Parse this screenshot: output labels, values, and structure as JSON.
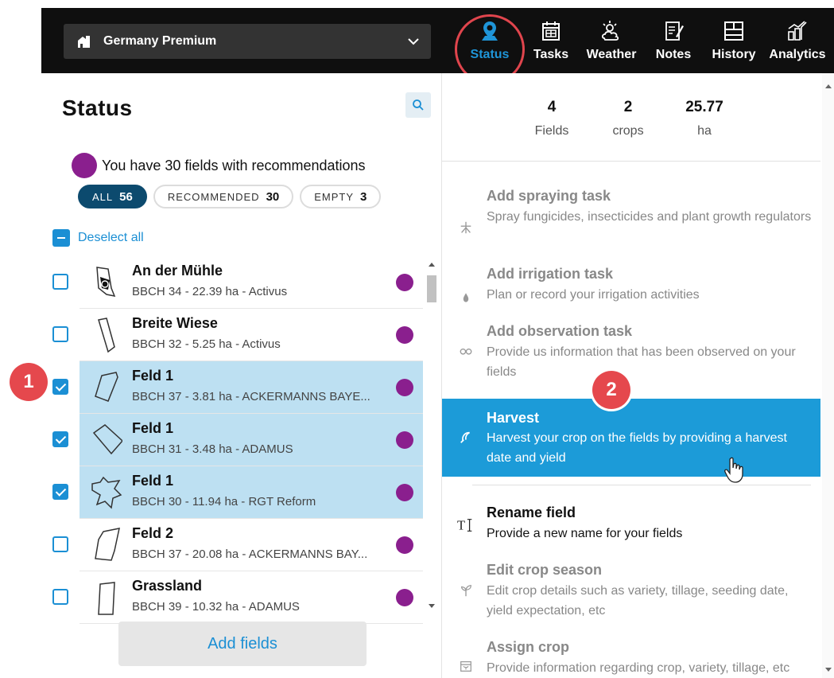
{
  "topbar": {
    "farm_name": "Germany Premium",
    "nav": [
      {
        "label": "Status",
        "icon": "map-pin-icon",
        "active": true
      },
      {
        "label": "Tasks",
        "icon": "calendar-icon"
      },
      {
        "label": "Weather",
        "icon": "weather-icon"
      },
      {
        "label": "Notes",
        "icon": "notes-icon"
      },
      {
        "label": "History",
        "icon": "history-icon"
      },
      {
        "label": "Analytics",
        "icon": "analytics-icon"
      }
    ]
  },
  "left": {
    "title": "Status",
    "recommendation_text": "You have 30 fields with recommendations",
    "filters": [
      {
        "label": "ALL",
        "count": "56",
        "active": true
      },
      {
        "label": "RECOMMENDED",
        "count": "30"
      },
      {
        "label": "EMPTY",
        "count": "3"
      }
    ],
    "deselect_label": "Deselect all",
    "fields": [
      {
        "name": "An der Mühle",
        "meta": "BBCH 34 - 22.39 ha - Activus",
        "checked": false
      },
      {
        "name": "Breite Wiese",
        "meta": "BBCH 32 - 5.25 ha - Activus",
        "checked": false
      },
      {
        "name": "Feld 1",
        "meta": "BBCH 37 - 3.81 ha - ACKERMANNS BAYE...",
        "checked": true
      },
      {
        "name": "Feld 1",
        "meta": "BBCH 31 - 3.48 ha - ADAMUS",
        "checked": true
      },
      {
        "name": "Feld 1",
        "meta": "BBCH 30 - 11.94 ha - RGT Reform",
        "checked": true
      },
      {
        "name": "Feld 2",
        "meta": "BBCH 37 - 20.08 ha - ACKERMANNS BAY...",
        "checked": false
      },
      {
        "name": "Grassland",
        "meta": "BBCH 39 - 10.32 ha - ADAMUS",
        "checked": false
      }
    ],
    "add_fields_label": "Add fields"
  },
  "right": {
    "stats": [
      {
        "value": "4",
        "label": "Fields"
      },
      {
        "value": "2",
        "label": "crops"
      },
      {
        "value": "25.77",
        "label": "ha"
      }
    ],
    "actions": [
      {
        "title": "Add spraying task",
        "desc": "Spray fungicides, insecticides and plant growth regulators",
        "icon": "spray-icon",
        "state": "disabled"
      },
      {
        "title": "Add irrigation task",
        "desc": "Plan or record your irrigation activities",
        "icon": "water-drop-icon",
        "state": "disabled"
      },
      {
        "title": "Add observation task",
        "desc": "Provide us information that has been observed on your fields",
        "icon": "binoculars-icon",
        "state": "disabled"
      },
      {
        "title": "Harvest",
        "desc": "Harvest your crop on the fields by providing a harvest date and yield",
        "icon": "sickle-icon",
        "state": "highlighted"
      },
      {
        "title": "Rename field",
        "desc": "Provide a new name for your fields",
        "icon": "text-cursor-icon",
        "state": "enabled"
      },
      {
        "title": "Edit crop season",
        "desc": "Edit crop details such as variety, tillage, seeding date, yield expectation, etc",
        "icon": "sprout-icon",
        "state": "disabled"
      },
      {
        "title": "Assign crop",
        "desc": "Provide information regarding crop, variety, tillage, etc",
        "icon": "calendar-crop-icon",
        "state": "disabled"
      }
    ]
  },
  "badges": {
    "one": "1",
    "two": "2"
  },
  "colors": {
    "accent": "#1b8fd4",
    "highlight": "#1c9bd8",
    "recommendation": "#8a1f8e",
    "selected_row": "#bde0f2",
    "badge": "#e5484d"
  }
}
